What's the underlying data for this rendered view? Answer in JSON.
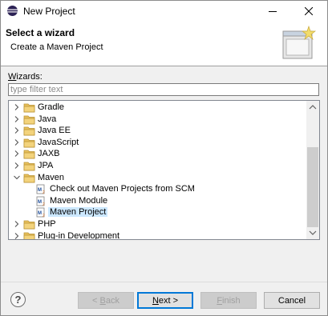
{
  "window": {
    "title": "New Project"
  },
  "header": {
    "title": "Select a wizard",
    "description": "Create a Maven Project"
  },
  "filter": {
    "label_mnemonic": "W",
    "label_rest": "izards:",
    "placeholder": "type filter text",
    "value": ""
  },
  "tree": {
    "items": [
      {
        "label": "Gradle",
        "type": "folder",
        "expanded": false
      },
      {
        "label": "Java",
        "type": "folder",
        "expanded": false
      },
      {
        "label": "Java EE",
        "type": "folder",
        "expanded": false
      },
      {
        "label": "JavaScript",
        "type": "folder",
        "expanded": false
      },
      {
        "label": "JAXB",
        "type": "folder",
        "expanded": false
      },
      {
        "label": "JPA",
        "type": "folder",
        "expanded": false
      },
      {
        "label": "Maven",
        "type": "folder",
        "expanded": true
      },
      {
        "label": "Check out Maven Projects from SCM",
        "type": "maven-item"
      },
      {
        "label": "Maven Module",
        "type": "maven-item"
      },
      {
        "label": "Maven Project",
        "type": "maven-item",
        "selected": true
      },
      {
        "label": "PHP",
        "type": "folder",
        "expanded": false
      },
      {
        "label": "Plug-in Development",
        "type": "folder",
        "expanded": false
      }
    ]
  },
  "buttons": {
    "help": "?",
    "back_prefix": "< ",
    "back_mnemonic": "B",
    "back_rest": "ack",
    "next_mnemonic": "N",
    "next_rest": "ext >",
    "finish_mnemonic": "F",
    "finish_rest": "inish",
    "cancel": "Cancel"
  },
  "colors": {
    "selection": "#cce8ff",
    "folder": "#e8c15e",
    "default_button_border": "#0078d7"
  }
}
